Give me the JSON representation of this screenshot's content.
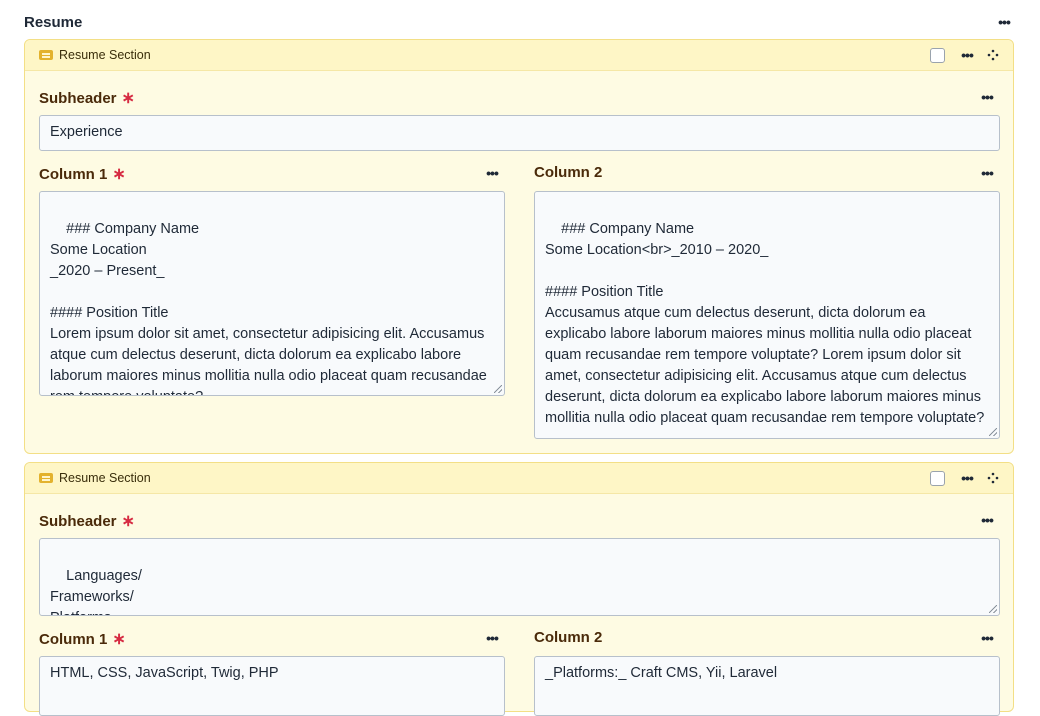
{
  "field": {
    "title": "Resume"
  },
  "blocks": [
    {
      "type_label": "Resume Section",
      "subheader_label": "Subheader",
      "subheader_value": "Experience",
      "col1_label": "Column 1",
      "col1_value": "### Company Name\nSome Location\n_2020 – Present_\n\n#### Position Title\nLorem ipsum dolor sit amet, consectetur adipisicing elit. Accusamus atque cum delectus deserunt, dicta dolorum ea explicabo labore laborum maiores minus mollitia nulla odio placeat quam recusandae rem tempore voluptate?",
      "col2_label": "Column 2",
      "col2_value": "### Company Name\nSome Location<br>_2010 – 2020_\n\n#### Position Title\nAccusamus atque cum delectus deserunt, dicta dolorum ea explicabo labore laborum maiores minus mollitia nulla odio placeat quam recusandae rem tempore voluptate? Lorem ipsum dolor sit amet, consectetur adipisicing elit. Accusamus atque cum delectus deserunt, dicta dolorum ea explicabo labore laborum maiores minus mollitia nulla odio placeat quam recusandae rem tempore voluptate?"
    },
    {
      "type_label": "Resume Section",
      "subheader_label": "Subheader",
      "subheader_value": "Languages/\nFrameworks/\nPlatforms",
      "col1_label": "Column 1",
      "col1_value": "HTML, CSS, JavaScript, Twig, PHP",
      "col2_label": "Column 2",
      "col2_value": "_Platforms:_ Craft CMS, Yii, Laravel"
    }
  ],
  "ui": {
    "required_marker": "∗",
    "menu_glyph": "•••",
    "icons": {
      "type": "resume-section-icon",
      "menu": "ellipsis-icon",
      "move": "move-icon",
      "select": "checkbox"
    },
    "colors": {
      "block_bg": "#fefbe3",
      "block_border": "#f3df86",
      "label": "#4a2a0a",
      "required": "#d62b42"
    }
  }
}
